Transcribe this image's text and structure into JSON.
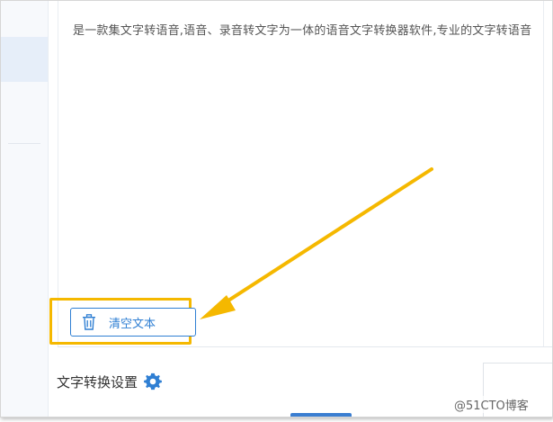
{
  "editor": {
    "description": "是一款集文字转语音,语音、录音转文字为一体的语音文字转换器软件,专业的文字转语音"
  },
  "toolbar": {
    "clear_label": "清空文本"
  },
  "settings": {
    "title": "文字转换设置"
  },
  "watermark": "@51CTO博客",
  "colors": {
    "accent": "#2f7fd3",
    "highlight": "#f5b800",
    "gear": "#2f7fd3"
  }
}
